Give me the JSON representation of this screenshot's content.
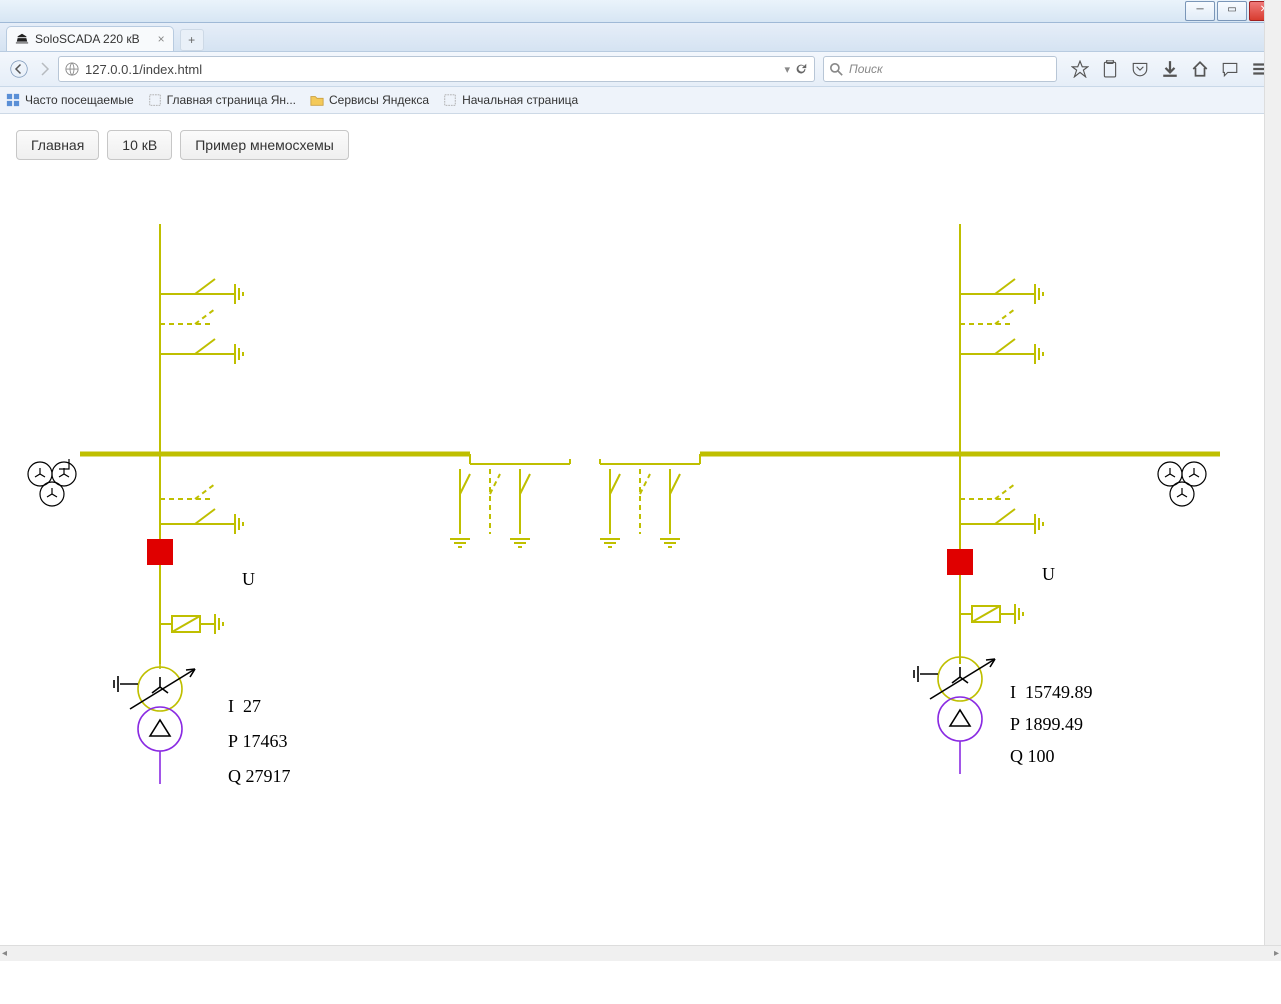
{
  "window": {
    "min_tip": "Minimize",
    "max_tip": "Maximize",
    "close_tip": "Close"
  },
  "tab": {
    "title": "SoloSCADA 220 кВ"
  },
  "nav": {
    "url": "127.0.0.1/index.html",
    "search_placeholder": "Поиск"
  },
  "bookmarks": [
    {
      "label": "Часто посещаемые"
    },
    {
      "label": "Главная страница Ян..."
    },
    {
      "label": "Сервисы Яндекса"
    },
    {
      "label": "Начальная страница"
    }
  ],
  "buttons": {
    "home": "Главная",
    "kv10": "10 кВ",
    "example": "Пример мнемосхемы"
  },
  "labels": {
    "U": "U",
    "I": "I",
    "P": "P",
    "Q": "Q"
  },
  "left": {
    "I": "27",
    "P": "17463",
    "Q": "27917"
  },
  "right": {
    "I": "15749.89",
    "P": "1899.49",
    "Q": "100"
  },
  "colors": {
    "bus": "#bfbf00",
    "breaker": "#e00000",
    "vt": "#8a2be2"
  }
}
